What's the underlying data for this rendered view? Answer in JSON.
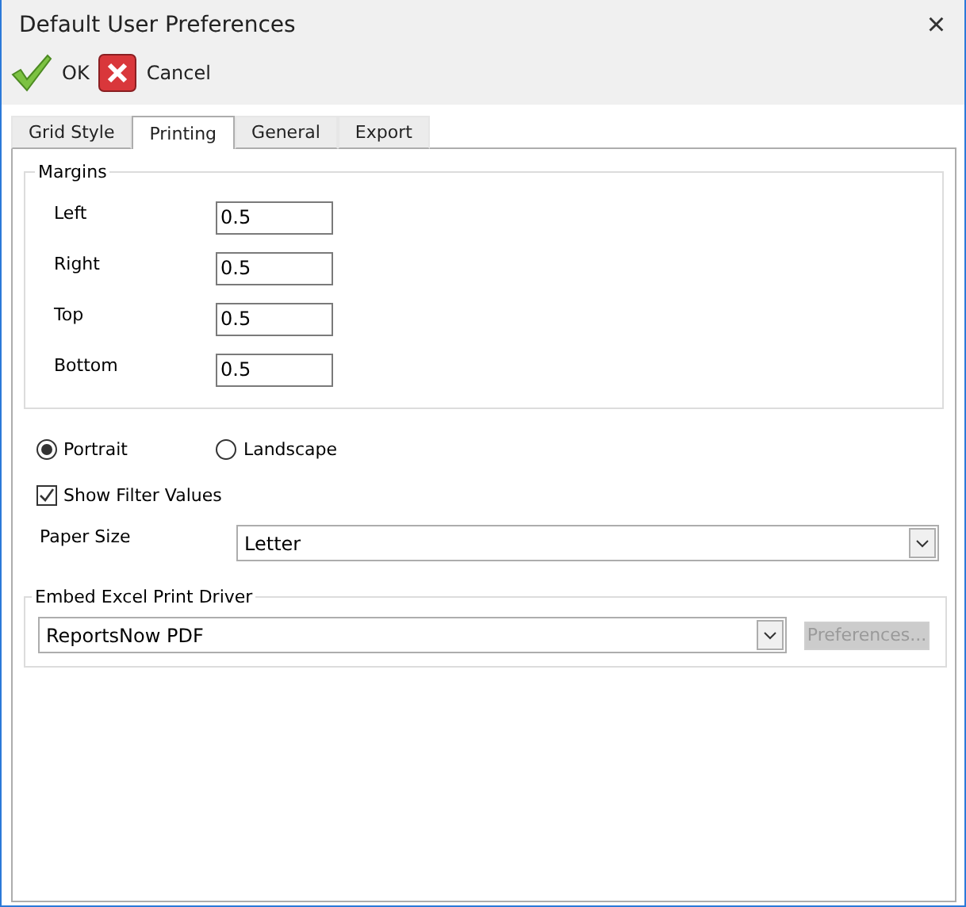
{
  "window": {
    "title": "Default User Preferences",
    "close": "×"
  },
  "toolbar": [
    {
      "kind": "ok",
      "label": "OK"
    },
    {
      "kind": "cancel",
      "label": "Cancel"
    }
  ],
  "tabs": [
    {
      "label": "Grid Style",
      "selected": false
    },
    {
      "label": "Printing",
      "selected": true
    },
    {
      "label": "General",
      "selected": false
    },
    {
      "label": "Export",
      "selected": false
    }
  ],
  "margins": {
    "title": "Margins",
    "fields": [
      {
        "label": "Left",
        "value": "0.5"
      },
      {
        "label": "Right",
        "value": "0.5"
      },
      {
        "label": "Top",
        "value": "0.5"
      },
      {
        "label": "Bottom",
        "value": "0.5"
      }
    ]
  },
  "orientation": [
    {
      "label": "Portrait",
      "selected": true
    },
    {
      "label": "Landscape",
      "selected": false
    }
  ],
  "show_filter_values": {
    "label": "Show Filter Values",
    "checked": true
  },
  "paper_size": {
    "label": "Paper Size",
    "value": "Letter"
  },
  "print_driver": {
    "title": "Embed Excel Print Driver",
    "value": "ReportsNow PDF",
    "button": {
      "label": "Preferences...",
      "disabled": true
    }
  }
}
